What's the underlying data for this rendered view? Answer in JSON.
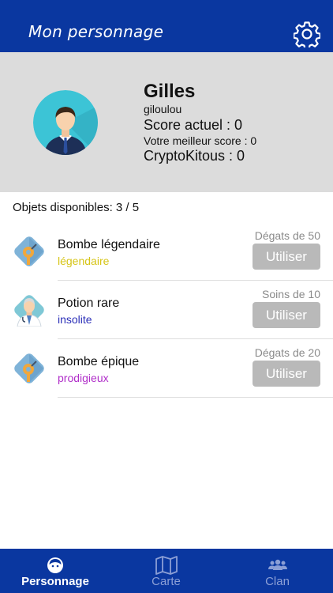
{
  "header": {
    "title": "Mon personnage"
  },
  "profile": {
    "name": "Gilles",
    "username": "giloulou",
    "score": "Score actuel : 0",
    "best_score": "Votre meilleur score : 0",
    "crypto": "CryptoKitous : 0"
  },
  "items_available": "Objets disponibles: 3 / 5",
  "items": [
    {
      "name": "Bombe légendaire",
      "rarity": "légendaire",
      "rarity_color": "#d6c416",
      "effect": "Dégats de 50",
      "action": "Utiliser",
      "icon": "bomb-icon"
    },
    {
      "name": "Potion rare",
      "rarity": "insolite",
      "rarity_color": "#2b2fb8",
      "effect": "Soins de 10",
      "action": "Utiliser",
      "icon": "doctor-icon"
    },
    {
      "name": "Bombe épique",
      "rarity": "prodigieux",
      "rarity_color": "#b02ec9",
      "effect": "Dégats de 20",
      "action": "Utiliser",
      "icon": "bomb-icon"
    }
  ],
  "tabs": [
    {
      "label": "Personnage",
      "icon": "user-face-icon",
      "active": true
    },
    {
      "label": "Carte",
      "icon": "map-icon",
      "active": false
    },
    {
      "label": "Clan",
      "icon": "group-icon",
      "active": false
    }
  ],
  "colors": {
    "primary": "#0a37a0",
    "profile_bg": "#dcdcdc",
    "button_bg": "#b9b9b9"
  }
}
